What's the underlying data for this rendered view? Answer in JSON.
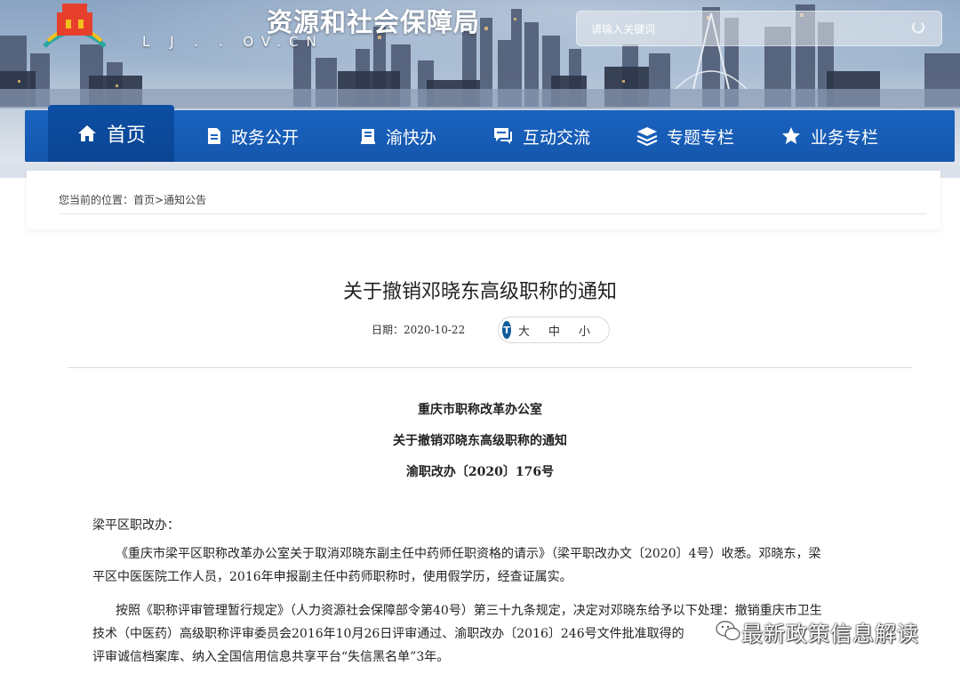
{
  "header": {
    "site_name": "资源和社会保障局",
    "site_url": "L J .  . OV.CN",
    "search_placeholder": "请输入关键词"
  },
  "nav": {
    "items": [
      {
        "label": "首页",
        "icon": "home-icon"
      },
      {
        "label": "政务公开",
        "icon": "document-icon"
      },
      {
        "label": "渝快办",
        "icon": "book-icon"
      },
      {
        "label": "互动交流",
        "icon": "chat-icon"
      },
      {
        "label": "专题专栏",
        "icon": "layers-icon"
      },
      {
        "label": "业务专栏",
        "icon": "star-icon"
      }
    ]
  },
  "breadcrumb": {
    "prefix": "您当前的位置：",
    "home": "首页",
    "sep": ">",
    "current": "通知公告"
  },
  "article": {
    "title": "关于撤销邓晓东高级职称的通知",
    "date_label": "日期：",
    "date": "2020-10-22",
    "size_badge": "T",
    "sizes": [
      "大",
      "中",
      "小"
    ],
    "issuer": "重庆市职称改革办公室",
    "doc_title": "关于撤销邓晓东高级职称的通知",
    "doc_number": "渝职改办〔2020〕176号",
    "salutation": "梁平区职改办：",
    "para1_line1": "《重庆市梁平区职称改革办公室关于取消邓晓东副主任中药师任职资格的请示》（梁平职改办文〔2020〕4号）收悉。邓晓东，梁",
    "para1_line2": "平区中医医院工作人员，2016年申报副主任中药师职称时，使用假学历，经查证属实。",
    "para2_line1": "按照《职称评审管理暂行规定》（人力资源社会保障部令第40号）第三十九条规定，决定对邓晓东给予以下处理：撤销重庆市卫生",
    "para2_line2": "技术（中医药）高级职称评审委员会2016年10月26日评审通过、渝职改办〔2016〕246号文件批准取得的",
    "para2_line3": "评审诚信档案库、纳入全国信用信息共享平台“失信黑名单”3年。"
  },
  "watermark": {
    "text": "最新政策信息解读"
  },
  "colors": {
    "nav_blue": "#1a63c0",
    "nav_active": "#0d4ea3",
    "badge_blue": "#0f5c9c"
  }
}
